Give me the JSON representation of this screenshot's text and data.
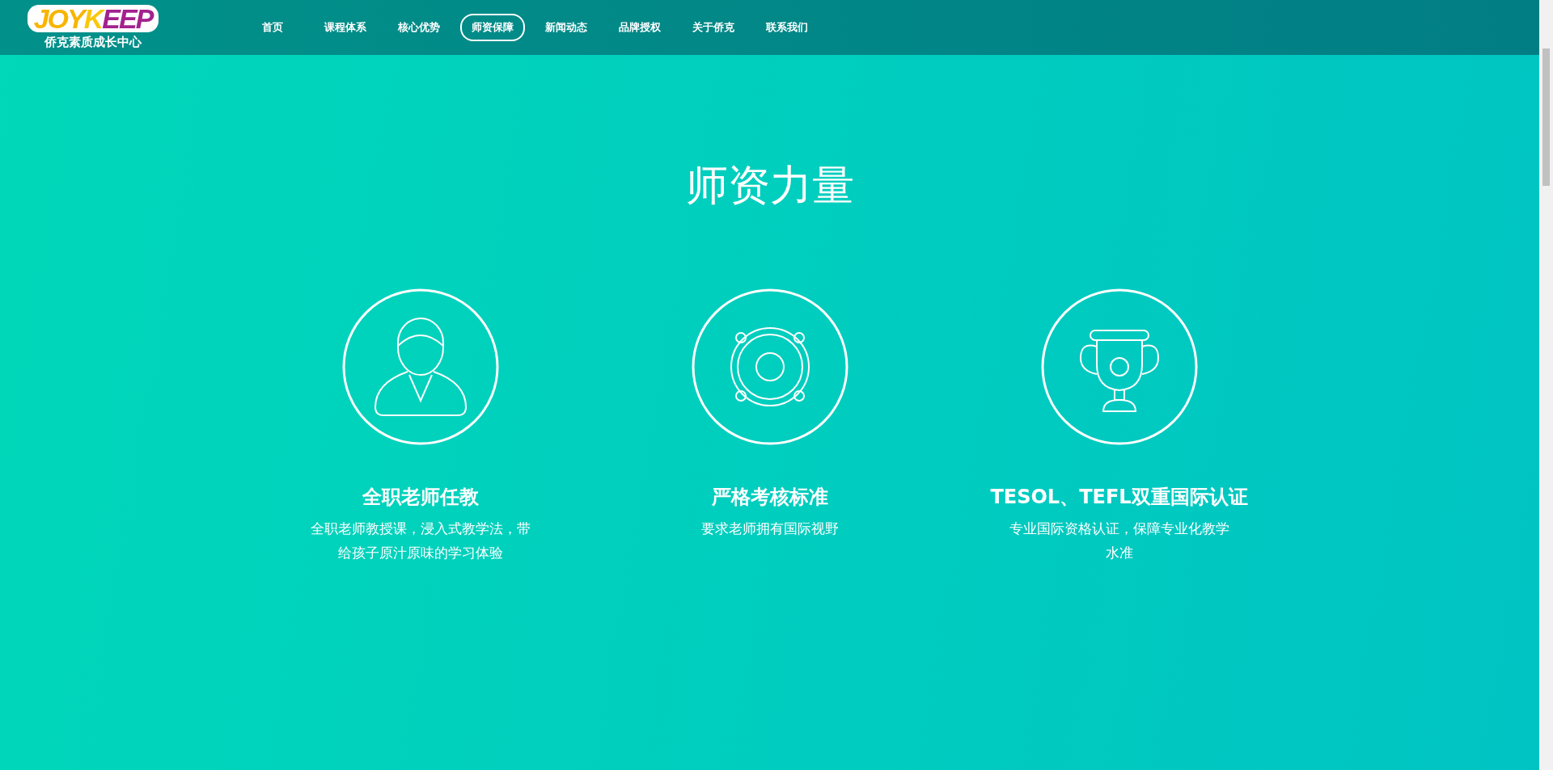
{
  "header": {
    "logo": {
      "wordmark": [
        {
          "text": "JOY",
          "color": "#f7b500"
        },
        {
          "text": "K",
          "color": "#f9c80e"
        },
        {
          "text": "EEP",
          "color": "#a3228e"
        }
      ],
      "tagline": "侨克素质成长中心"
    },
    "nav": [
      {
        "label": "首页",
        "selected": false
      },
      {
        "label": "课程体系",
        "selected": false
      },
      {
        "label": "核心优势",
        "selected": false
      },
      {
        "label": "师资保障",
        "selected": true
      },
      {
        "label": "新闻动态",
        "selected": false
      },
      {
        "label": "品牌授权",
        "selected": false
      },
      {
        "label": "关于侨克",
        "selected": false
      },
      {
        "label": "联系我们",
        "selected": false
      }
    ]
  },
  "section": {
    "title": "师资力量",
    "features": [
      {
        "kind": "person",
        "title": "全职老师任教",
        "description": "全职老师教授课，浸入式教学法，带给孩子原汁原味的学习体验"
      },
      {
        "kind": "speaker",
        "title": "严格考核标准",
        "description": "要求老师拥有国际视野"
      },
      {
        "kind": "trophy",
        "title": "TESOL、TEFL双重国际认证",
        "description": "专业国际资格认证，保障专业化教学水准"
      }
    ]
  }
}
